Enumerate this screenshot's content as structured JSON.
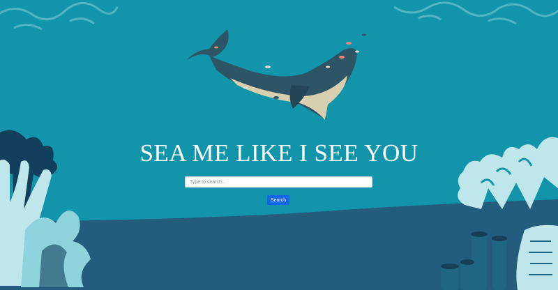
{
  "hero": {
    "title": "SEA ME LIKE I SEE YOU"
  },
  "search": {
    "placeholder": "Type to search...",
    "value": "",
    "button_label": "Search"
  },
  "colors": {
    "water": "#1295ab",
    "seabed": "#235c7c",
    "accent_button": "#1565ea",
    "coral_light": "#bfe6ea",
    "coral_dark": "#123f5b",
    "whale_body": "#2e5566",
    "whale_belly": "#d8cfae"
  }
}
